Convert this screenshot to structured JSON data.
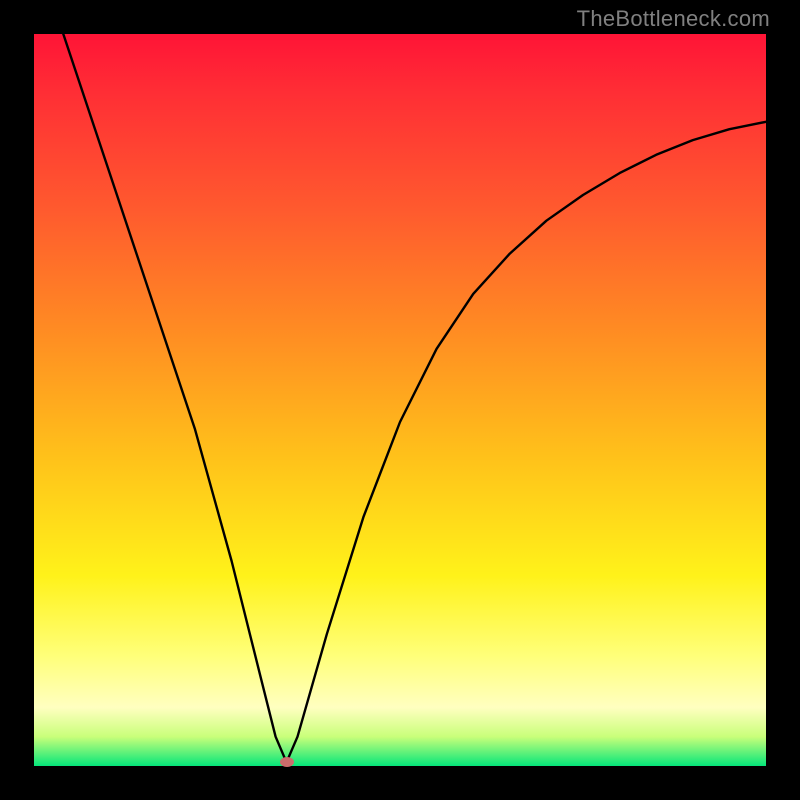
{
  "watermark": "TheBottleneck.com",
  "chart_data": {
    "type": "line",
    "title": "",
    "xlabel": "",
    "ylabel": "",
    "xlim": [
      0,
      100
    ],
    "ylim": [
      0,
      100
    ],
    "grid": false,
    "series": [
      {
        "name": "bottleneck-curve",
        "x": [
          4,
          10,
          16,
          22,
          27,
          31,
          33,
          34.5,
          36,
          40,
          45,
          50,
          55,
          60,
          65,
          70,
          75,
          80,
          85,
          90,
          95,
          100
        ],
        "values": [
          100,
          82,
          64,
          46,
          28,
          12,
          4,
          0.5,
          4,
          18,
          34,
          47,
          57,
          64.5,
          70,
          74.5,
          78,
          81,
          83.5,
          85.5,
          87,
          88
        ]
      }
    ],
    "marker": {
      "x": 34.5,
      "y": 0.5,
      "color": "#cc6d6d"
    },
    "background_gradient": {
      "from": "#ff1436",
      "to": "#05e67a",
      "stops": [
        "#ff5a2e",
        "#ffc21a",
        "#fff21a",
        "#ffffc0"
      ]
    }
  }
}
